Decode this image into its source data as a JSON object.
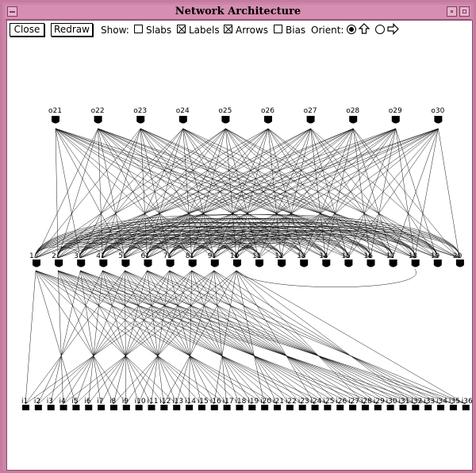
{
  "window": {
    "title": "Network Architecture"
  },
  "toolbar": {
    "close_label": "Close",
    "redraw_label": "Redraw",
    "show_label": "Show:",
    "slabs_label": "Slabs",
    "slabs_checked": false,
    "labels_label": "Labels",
    "labels_checked": true,
    "arrows_label": "Arrows",
    "arrows_checked": true,
    "bias_label": "Bias",
    "bias_checked": false,
    "orient_label": "Orient:",
    "orient_options": [
      "up-arrow-icon",
      "right-arrow-icon"
    ],
    "orient_selected": "up"
  },
  "network": {
    "input_labels": [
      "i1",
      "i2",
      "i3",
      "i4",
      "i5",
      "i6",
      "i7",
      "i8",
      "i9",
      "i10",
      "i11",
      "i12",
      "i13",
      "i14",
      "i15",
      "i16",
      "i17",
      "i18",
      "i19",
      "i20",
      "i21",
      "i22",
      "i23",
      "i24",
      "i25",
      "i26",
      "i27",
      "i28",
      "i29",
      "i30",
      "i31",
      "i32",
      "i33",
      "i34",
      "i35",
      "i36"
    ],
    "hidden_labels": [
      "1",
      "2",
      "3",
      "4",
      "5",
      "6",
      "7",
      "8",
      "9",
      "10",
      "11",
      "12",
      "13",
      "14",
      "15",
      "16",
      "17",
      "18",
      "19",
      "20"
    ],
    "output_labels": [
      "o21",
      "o22",
      "o23",
      "o24",
      "o25",
      "o26",
      "o27",
      "o28",
      "o29",
      "o30"
    ]
  }
}
